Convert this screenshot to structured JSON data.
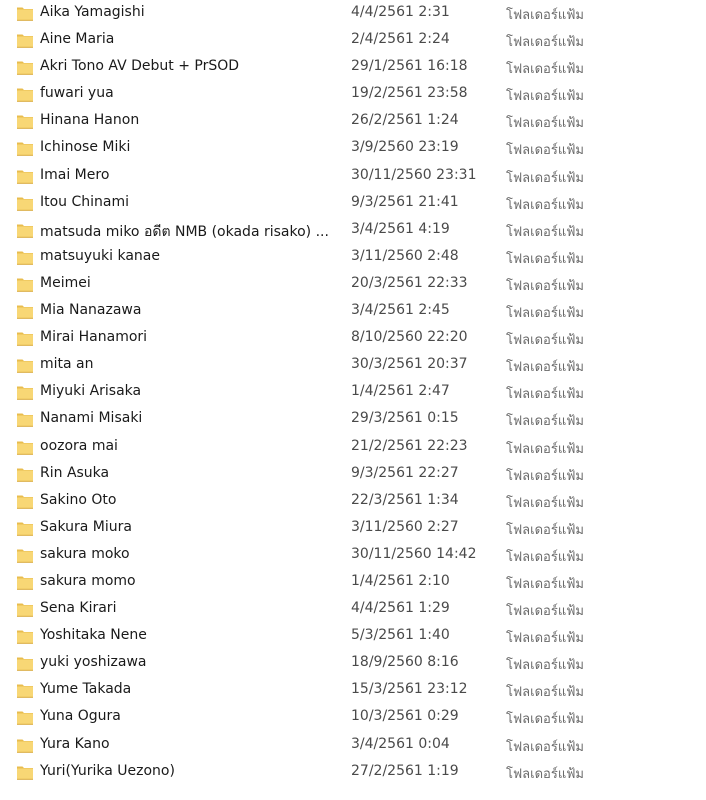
{
  "files": [
    {
      "name": "Aika Yamagishi",
      "date": "4/4/2561 2:31",
      "type": "โฟลเดอร์แฟ้ม",
      "icon": "folder-icon"
    },
    {
      "name": "Aine Maria",
      "date": "2/4/2561 2:24",
      "type": "โฟลเดอร์แฟ้ม",
      "icon": "folder-icon"
    },
    {
      "name": "Akri Tono AV Debut + PrSOD",
      "date": "29/1/2561 16:18",
      "type": "โฟลเดอร์แฟ้ม",
      "icon": "folder-icon"
    },
    {
      "name": "fuwari yua",
      "date": "19/2/2561 23:58",
      "type": "โฟลเดอร์แฟ้ม",
      "icon": "folder-icon"
    },
    {
      "name": "Hinana Hanon",
      "date": "26/2/2561 1:24",
      "type": "โฟลเดอร์แฟ้ม",
      "icon": "folder-icon"
    },
    {
      "name": "Ichinose Miki",
      "date": "3/9/2560 23:19",
      "type": "โฟลเดอร์แฟ้ม",
      "icon": "folder-icon"
    },
    {
      "name": "Imai Mero",
      "date": "30/11/2560 23:31",
      "type": "โฟลเดอร์แฟ้ม",
      "icon": "folder-icon"
    },
    {
      "name": "Itou Chinami",
      "date": "9/3/2561 21:41",
      "type": "โฟลเดอร์แฟ้ม",
      "icon": "folder-icon"
    },
    {
      "name": "matsuda miko อดีต NMB (okada risako) ...",
      "date": "3/4/2561 4:19",
      "type": "โฟลเดอร์แฟ้ม",
      "icon": "folder-icon"
    },
    {
      "name": "matsuyuki kanae",
      "date": "3/11/2560 2:48",
      "type": "โฟลเดอร์แฟ้ม",
      "icon": "folder-icon"
    },
    {
      "name": "Meimei",
      "date": "20/3/2561 22:33",
      "type": "โฟลเดอร์แฟ้ม",
      "icon": "folder-icon"
    },
    {
      "name": "Mia Nanazawa",
      "date": "3/4/2561 2:45",
      "type": "โฟลเดอร์แฟ้ม",
      "icon": "folder-icon"
    },
    {
      "name": "Mirai Hanamori",
      "date": "8/10/2560 22:20",
      "type": "โฟลเดอร์แฟ้ม",
      "icon": "folder-icon"
    },
    {
      "name": "mita an",
      "date": "30/3/2561 20:37",
      "type": "โฟลเดอร์แฟ้ม",
      "icon": "folder-icon"
    },
    {
      "name": "Miyuki Arisaka",
      "date": "1/4/2561 2:47",
      "type": "โฟลเดอร์แฟ้ม",
      "icon": "folder-icon"
    },
    {
      "name": "Nanami Misaki",
      "date": "29/3/2561 0:15",
      "type": "โฟลเดอร์แฟ้ม",
      "icon": "folder-icon"
    },
    {
      "name": "oozora mai",
      "date": "21/2/2561 22:23",
      "type": "โฟลเดอร์แฟ้ม",
      "icon": "folder-icon"
    },
    {
      "name": "Rin Asuka",
      "date": "9/3/2561 22:27",
      "type": "โฟลเดอร์แฟ้ม",
      "icon": "folder-icon"
    },
    {
      "name": "Sakino Oto",
      "date": "22/3/2561 1:34",
      "type": "โฟลเดอร์แฟ้ม",
      "icon": "folder-icon"
    },
    {
      "name": "Sakura Miura",
      "date": "3/11/2560 2:27",
      "type": "โฟลเดอร์แฟ้ม",
      "icon": "folder-icon"
    },
    {
      "name": "sakura moko",
      "date": "30/11/2560 14:42",
      "type": "โฟลเดอร์แฟ้ม",
      "icon": "folder-icon"
    },
    {
      "name": "sakura momo",
      "date": "1/4/2561 2:10",
      "type": "โฟลเดอร์แฟ้ม",
      "icon": "folder-icon"
    },
    {
      "name": "Sena Kirari",
      "date": "4/4/2561 1:29",
      "type": "โฟลเดอร์แฟ้ม",
      "icon": "folder-icon"
    },
    {
      "name": "Yoshitaka Nene",
      "date": "5/3/2561 1:40",
      "type": "โฟลเดอร์แฟ้ม",
      "icon": "folder-icon"
    },
    {
      "name": "yuki yoshizawa",
      "date": "18/9/2560 8:16",
      "type": "โฟลเดอร์แฟ้ม",
      "icon": "folder-icon"
    },
    {
      "name": "Yume Takada",
      "date": "15/3/2561 23:12",
      "type": "โฟลเดอร์แฟ้ม",
      "icon": "folder-icon"
    },
    {
      "name": "Yuna Ogura",
      "date": "10/3/2561 0:29",
      "type": "โฟลเดอร์แฟ้ม",
      "icon": "folder-icon"
    },
    {
      "name": "Yura Kano",
      "date": "3/4/2561 0:04",
      "type": "โฟลเดอร์แฟ้ม",
      "icon": "folder-icon"
    },
    {
      "name": "Yuri(Yurika Uezono)",
      "date": "27/2/2561 1:19",
      "type": "โฟลเดอร์แฟ้ม",
      "icon": "folder-icon"
    }
  ],
  "colors": {
    "folder_fill": "#F8D775",
    "folder_tab": "#E8BC4E",
    "folder_edge": "#D9A93A"
  }
}
